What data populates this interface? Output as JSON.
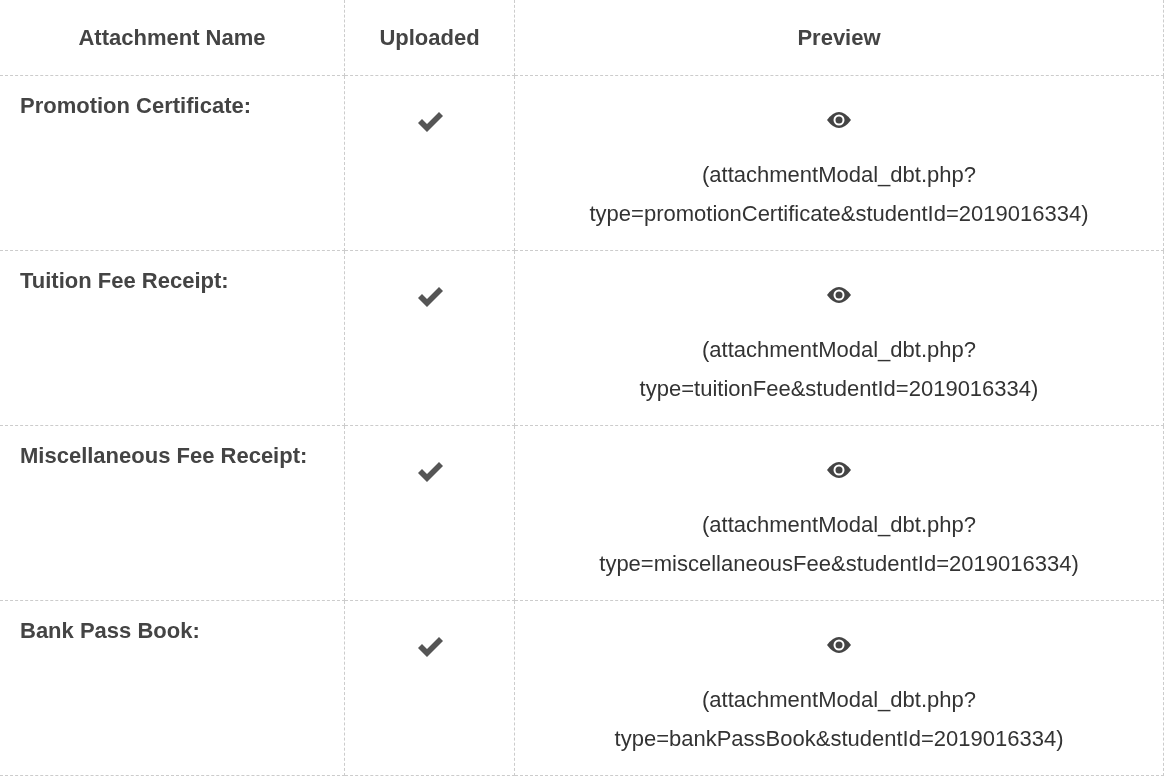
{
  "table": {
    "columns": [
      "Attachment Name",
      "Uploaded",
      "Preview"
    ],
    "rows": [
      {
        "name": "Promotion Certificate:",
        "uploaded": true,
        "preview_lines": [
          "(attachmentModal_dbt.php?",
          "type=promotionCertificate&studentId=2019016334)"
        ]
      },
      {
        "name": "Tuition Fee Receipt:",
        "uploaded": true,
        "preview_lines": [
          "(attachmentModal_dbt.php?",
          "type=tuitionFee&studentId=2019016334)"
        ]
      },
      {
        "name": "Miscellaneous Fee Receipt:",
        "uploaded": true,
        "preview_lines": [
          "(attachmentModal_dbt.php?",
          "type=miscellaneousFee&studentId=2019016334)"
        ]
      },
      {
        "name": "Bank Pass Book:",
        "uploaded": true,
        "preview_lines": [
          "(attachmentModal_dbt.php?",
          "type=bankPassBook&studentId=2019016334)"
        ]
      }
    ]
  }
}
